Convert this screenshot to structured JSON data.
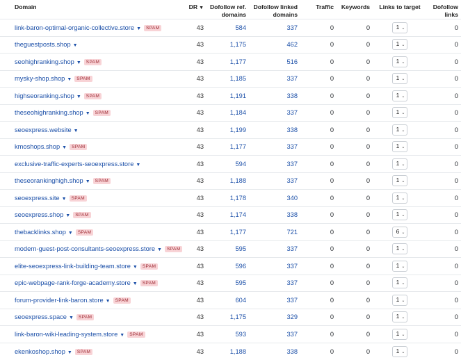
{
  "columns": {
    "domain": "Domain",
    "dr": "DR",
    "dofollow_ref_1": "Dofollow ref.",
    "dofollow_ref_2": "domains",
    "dofollow_linked_1": "Dofollow linked",
    "dofollow_linked_2": "domains",
    "traffic": "Traffic",
    "keywords": "Keywords",
    "links_to_target": "Links to target",
    "dofollow_links_1": "Dofollow",
    "dofollow_links_2": "links"
  },
  "spam_label": "SPAM",
  "rows": [
    {
      "domain": "link-baron-optimal-organic-collective.store",
      "spam": true,
      "dr": "43",
      "ref": "584",
      "linked": "337",
      "traffic": "0",
      "keywords": "0",
      "links": "1",
      "dofollow": "0"
    },
    {
      "domain": "theguestposts.shop",
      "spam": false,
      "dr": "43",
      "ref": "1,175",
      "linked": "462",
      "traffic": "0",
      "keywords": "0",
      "links": "1",
      "dofollow": "0"
    },
    {
      "domain": "seohighranking.shop",
      "spam": true,
      "dr": "43",
      "ref": "1,177",
      "linked": "516",
      "traffic": "0",
      "keywords": "0",
      "links": "1",
      "dofollow": "0"
    },
    {
      "domain": "mysky-shop.shop",
      "spam": true,
      "dr": "43",
      "ref": "1,185",
      "linked": "337",
      "traffic": "0",
      "keywords": "0",
      "links": "1",
      "dofollow": "0"
    },
    {
      "domain": "highseoranking.shop",
      "spam": true,
      "dr": "43",
      "ref": "1,191",
      "linked": "338",
      "traffic": "0",
      "keywords": "0",
      "links": "1",
      "dofollow": "0"
    },
    {
      "domain": "theseohighranking.shop",
      "spam": true,
      "dr": "43",
      "ref": "1,184",
      "linked": "337",
      "traffic": "0",
      "keywords": "0",
      "links": "1",
      "dofollow": "0"
    },
    {
      "domain": "seoexpress.website",
      "spam": false,
      "dr": "43",
      "ref": "1,199",
      "linked": "338",
      "traffic": "0",
      "keywords": "0",
      "links": "1",
      "dofollow": "0"
    },
    {
      "domain": "kmoshops.shop",
      "spam": true,
      "dr": "43",
      "ref": "1,177",
      "linked": "337",
      "traffic": "0",
      "keywords": "0",
      "links": "1",
      "dofollow": "0"
    },
    {
      "domain": "exclusive-traffic-experts-seoexpress.store",
      "spam": false,
      "dr": "43",
      "ref": "594",
      "linked": "337",
      "traffic": "0",
      "keywords": "0",
      "links": "1",
      "dofollow": "0"
    },
    {
      "domain": "theseorankinghigh.shop",
      "spam": true,
      "dr": "43",
      "ref": "1,188",
      "linked": "337",
      "traffic": "0",
      "keywords": "0",
      "links": "1",
      "dofollow": "0"
    },
    {
      "domain": "seoexpress.site",
      "spam": true,
      "dr": "43",
      "ref": "1,178",
      "linked": "340",
      "traffic": "0",
      "keywords": "0",
      "links": "1",
      "dofollow": "0"
    },
    {
      "domain": "seoexpress.shop",
      "spam": true,
      "dr": "43",
      "ref": "1,174",
      "linked": "338",
      "traffic": "0",
      "keywords": "0",
      "links": "1",
      "dofollow": "0"
    },
    {
      "domain": "thebacklinks.shop",
      "spam": true,
      "dr": "43",
      "ref": "1,177",
      "linked": "721",
      "traffic": "0",
      "keywords": "0",
      "links": "6",
      "dofollow": "0"
    },
    {
      "domain": "modern-guest-post-consultants-seoexpress.store",
      "spam": true,
      "dr": "43",
      "ref": "595",
      "linked": "337",
      "traffic": "0",
      "keywords": "0",
      "links": "1",
      "dofollow": "0"
    },
    {
      "domain": "elite-seoexpress-link-building-team.store",
      "spam": true,
      "dr": "43",
      "ref": "596",
      "linked": "337",
      "traffic": "0",
      "keywords": "0",
      "links": "1",
      "dofollow": "0"
    },
    {
      "domain": "epic-webpage-rank-forge-academy.store",
      "spam": true,
      "dr": "43",
      "ref": "595",
      "linked": "337",
      "traffic": "0",
      "keywords": "0",
      "links": "1",
      "dofollow": "0"
    },
    {
      "domain": "forum-provider-link-baron.store",
      "spam": true,
      "dr": "43",
      "ref": "604",
      "linked": "337",
      "traffic": "0",
      "keywords": "0",
      "links": "1",
      "dofollow": "0"
    },
    {
      "domain": "seoexpress.space",
      "spam": true,
      "dr": "43",
      "ref": "1,175",
      "linked": "329",
      "traffic": "0",
      "keywords": "0",
      "links": "1",
      "dofollow": "0"
    },
    {
      "domain": "link-baron-wiki-leading-system.store",
      "spam": true,
      "dr": "43",
      "ref": "593",
      "linked": "337",
      "traffic": "0",
      "keywords": "0",
      "links": "1",
      "dofollow": "0"
    },
    {
      "domain": "ekenkoshop.shop",
      "spam": true,
      "dr": "43",
      "ref": "1,188",
      "linked": "338",
      "traffic": "0",
      "keywords": "0",
      "links": "1",
      "dofollow": "0"
    }
  ]
}
